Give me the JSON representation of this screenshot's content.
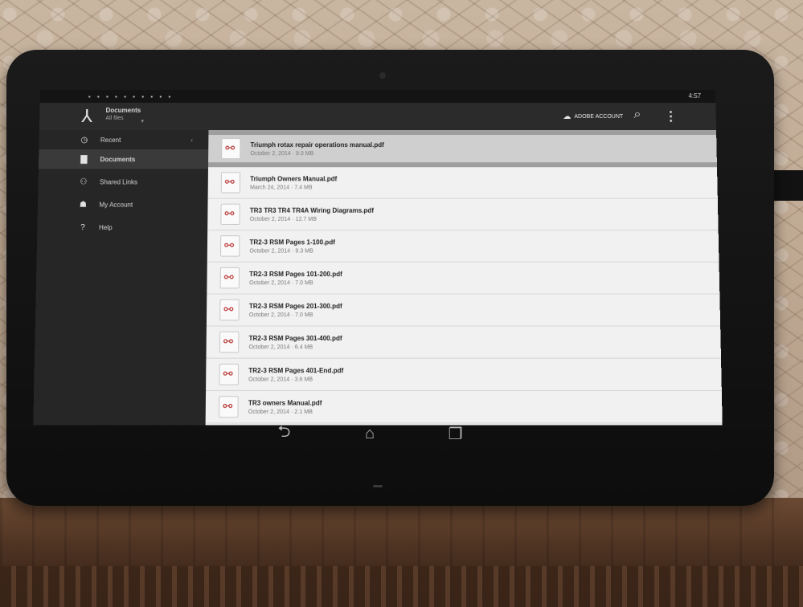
{
  "header": {
    "app_title": "Documents",
    "subtitle": "All files",
    "adobe_account": "ADOBE ACCOUNT",
    "status_left": "▪ ▪ ▪ ▪ ▪ ▪ ▪ ▪ ▪ ▪",
    "status_right": "4:57"
  },
  "icons": {
    "app_logo": "adobe-reader-logo-icon",
    "account": "adobe-account-icon",
    "search": "search-icon",
    "overflow": "overflow-menu-icon",
    "pdf": "pdf-file-icon",
    "back": "back-icon",
    "home": "home-icon",
    "recents": "recent-apps-icon"
  },
  "sidebar": {
    "items": [
      {
        "label": "Recent",
        "icon": "clock-icon",
        "active": false
      },
      {
        "label": "Documents",
        "icon": "document-icon",
        "active": true
      },
      {
        "label": "Shared Links",
        "icon": "link-icon",
        "active": false
      },
      {
        "label": "My Account",
        "icon": "account-icon",
        "active": false
      },
      {
        "label": "Help",
        "icon": "help-icon",
        "active": false
      }
    ]
  },
  "files": {
    "selected": {
      "name": "Triumph rotax repair operations manual.pdf",
      "meta": "October 2, 2014 · 9.0 MB"
    },
    "items": [
      {
        "name": "Triumph Owners Manual.pdf",
        "meta": "March 24, 2014 · 7.4 MB"
      },
      {
        "name": "TR3 TR3 TR4 TR4A Wiring Diagrams.pdf",
        "meta": "October 2, 2014 · 12.7 MB"
      },
      {
        "name": "TR2-3 RSM Pages 1-100.pdf",
        "meta": "October 2, 2014 · 9.3 MB"
      },
      {
        "name": "TR2-3 RSM Pages 101-200.pdf",
        "meta": "October 2, 2014 · 7.0 MB"
      },
      {
        "name": "TR2-3 RSM Pages 201-300.pdf",
        "meta": "October 2, 2014 · 7.0 MB"
      },
      {
        "name": "TR2-3 RSM Pages 301-400.pdf",
        "meta": "October 2, 2014 · 6.4 MB"
      },
      {
        "name": "TR2-3 RSM Pages 401-End.pdf",
        "meta": "October 2, 2014 · 3.6 MB"
      },
      {
        "name": "TR3 owners Manual.pdf",
        "meta": "October 2, 2014 · 2.1 MB"
      }
    ]
  },
  "colors": {
    "sidebar_bg": "#262626",
    "active_item": "#3a3a3a",
    "list_bg": "#f1f1f1",
    "pdf_red": "#b32020"
  }
}
